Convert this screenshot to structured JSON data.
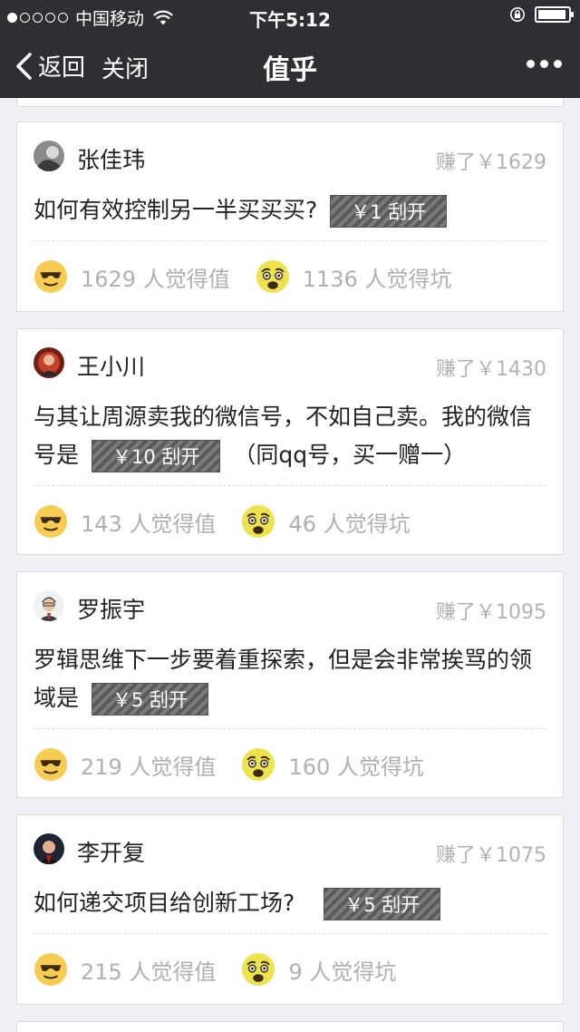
{
  "status_bar": {
    "carrier": "中国移动",
    "time": "下午5:12",
    "battery_level": 0.95
  },
  "nav": {
    "back_label": "返回",
    "close_label": "关闭",
    "title": "值乎"
  },
  "cards": [
    {
      "author": "张佳玮",
      "earned": "赚了￥1629",
      "question_text": "如何有效控制另一半买买买?",
      "question_text_after": "",
      "reveal_label": "￥1 刮开",
      "worth": "1629 人觉得值",
      "pit": "1136 人觉得坑"
    },
    {
      "author": "王小川",
      "earned": "赚了￥1430",
      "question_text": "与其让周源卖我的微信号，不如自己卖。我的微信号是",
      "question_text_after": "（同qq号，买一赠一）",
      "reveal_label": "￥10 刮开",
      "worth": "143 人觉得值",
      "pit": "46 人觉得坑"
    },
    {
      "author": "罗振宇",
      "earned": "赚了￥1095",
      "question_text": "罗辑思维下一步要着重探索，但是会非常挨骂的领域是",
      "question_text_after": "",
      "reveal_label": "￥5 刮开",
      "worth": "219 人觉得值",
      "pit": "160 人觉得坑"
    },
    {
      "author": "李开复",
      "earned": "赚了￥1075",
      "question_text": "如何递交项目给创新工场?",
      "question_text_after": "",
      "reveal_label": "￥5 刮开",
      "worth": "215 人觉得值",
      "pit": "9 人觉得坑"
    }
  ]
}
